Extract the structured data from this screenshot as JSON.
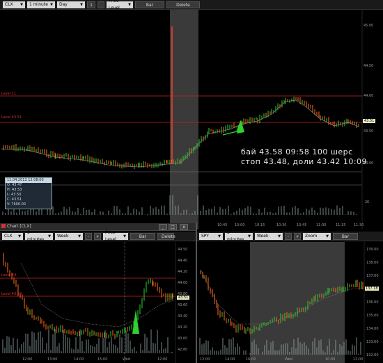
{
  "main": {
    "toolbar": {
      "symbol": "CLX",
      "interval": "1 minute",
      "range": "Day",
      "small_btn": "1",
      "price_level": "Price Level",
      "chart_type": "Bar",
      "delete_levels": "Delete Levels"
    },
    "levels": {
      "level1": "Level 11",
      "level2": "Level 43.51"
    },
    "price_axis": [
      "45.00",
      "44.50",
      "44.00",
      "43.50",
      "43.00"
    ],
    "current_price": "43.51",
    "volume_label": "2K",
    "time_axis": [
      "10:45",
      "10:00",
      "10:15",
      "10:30",
      "10:45",
      "11:00",
      "11:15",
      "11:30"
    ],
    "annotation_line1": "бай 43.58 09:58 100 шерс",
    "annotation_line2": "стоп 43.48, доли 43.42 10:09",
    "info": {
      "header": "11.04.2012 12:08:00",
      "rows": [
        "O: 43.47",
        "H: 43.53",
        "L: 43.50",
        "C: 43.51",
        "V: 7600.00"
      ]
    },
    "colors": {
      "up": "#2fd02f",
      "down": "#ff6a1a",
      "level": "#cc2222",
      "highlight": "#3a3a3a"
    }
  },
  "left_window": {
    "title": "Chart [CLX]",
    "toolbar": {
      "symbol": "CLX",
      "interval": "5 minutes",
      "range": "Week",
      "mode": "Price Level",
      "chart_type": "Bar",
      "delete": "Delete"
    },
    "price_axis": [
      "44.50",
      "44.40",
      "44.20",
      "44.00",
      "43.80",
      "43.60",
      "43.40",
      "43.20",
      "43.00",
      "42.80"
    ],
    "current_price": "43.51",
    "levels": {
      "level1": "Level 44",
      "level2": "Level 43.59"
    },
    "time_axis": [
      "12:00",
      "13:00",
      "14:00",
      "15:00",
      "Wed",
      "12:00"
    ]
  },
  "right_window": {
    "toolbar": {
      "symbol": "SPY",
      "interval": "5 minutes",
      "range": "Week",
      "mode": "Zoom",
      "chart_type": "Bar"
    },
    "price_axis": [
      "139.00",
      "138.00",
      "137.00",
      "137.00",
      "136.00",
      "135.00",
      "134.00",
      "133.00",
      "132.00"
    ],
    "current_price": "137.18",
    "time_axis": [
      "12:00",
      "14:00",
      "16:00",
      "Wed",
      "10:00",
      "12:00"
    ]
  }
}
